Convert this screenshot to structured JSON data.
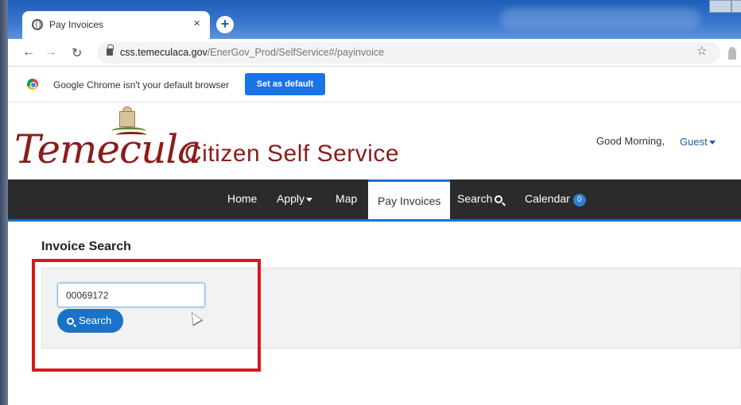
{
  "browser": {
    "tab_title": "Pay Invoices",
    "tab_close": "×",
    "new_tab": "+",
    "url_host": "css.temeculaca.gov",
    "url_path": "/EnerGov_Prod/SelfService#/payinvoice",
    "infobar_text": "Google Chrome isn't your default browser",
    "set_default_label": "Set as default",
    "icons": [
      "globe-icon",
      "close-icon",
      "plus-icon",
      "back-arrow-icon",
      "forward-arrow-icon",
      "reload-icon",
      "lock-icon",
      "star-icon",
      "chrome-logo-icon"
    ]
  },
  "site": {
    "logo_text": "Temecula",
    "title": "Citizen Self Service",
    "greeting": "Good Morning,",
    "user": "Guest",
    "brand_color": "#8b1c1c",
    "accent_color": "#1a73c9"
  },
  "nav": {
    "items": [
      {
        "label": "Home"
      },
      {
        "label": "Apply"
      },
      {
        "label": "Map"
      },
      {
        "label": "Pay Invoices",
        "active": true
      },
      {
        "label": "Search"
      },
      {
        "label": "Calendar",
        "badge": "0"
      }
    ]
  },
  "main": {
    "section_title": "Invoice Search",
    "invoice_value": "00069172",
    "search_label": "Search"
  }
}
